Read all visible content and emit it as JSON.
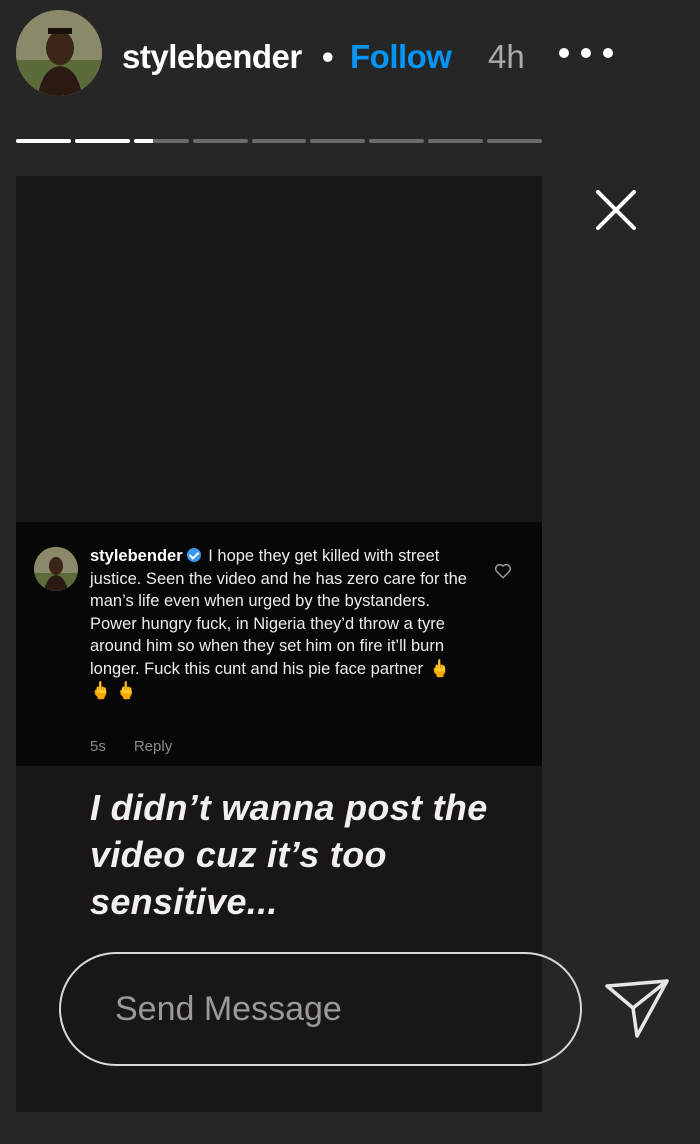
{
  "header": {
    "username": "stylebender",
    "separator": "•",
    "follow_label": "Follow",
    "time": "4h"
  },
  "progress": {
    "segments": [
      1,
      1,
      0.35,
      0,
      0,
      0,
      0,
      0,
      0
    ]
  },
  "comment": {
    "username": "stylebender",
    "text": "I hope they get killed with street justice. Seen the video and he has zero care for the man’s life even when urged by the bystanders. Power hungry fuck, in Nigeria they’d throw a tyre around  him so when they set him on fire it’ll burn longer. Fuck this cunt and his pie face partner",
    "emojis": "🖕 🖕 🖕",
    "time": "5s",
    "reply_label": "Reply"
  },
  "caption": "I didn’t wanna post the video cuz it’s too sensitive...",
  "message": {
    "placeholder": "Send Message"
  },
  "icons": {
    "more": "more-horizontal-icon",
    "close": "close-icon",
    "heart": "heart-outline-icon",
    "send": "send-paper-plane-icon",
    "verified": "verified-badge-icon"
  },
  "colors": {
    "background": "#262626",
    "follow": "#0095f6",
    "verified": "#3897f0"
  }
}
